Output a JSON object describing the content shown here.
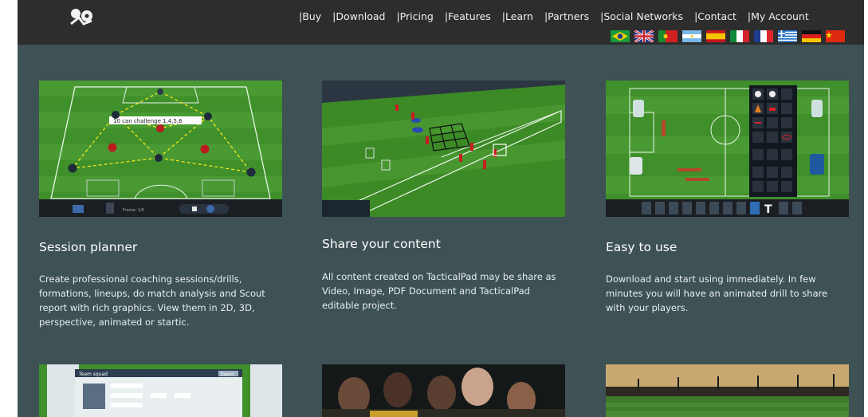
{
  "nav": {
    "items": [
      "|Buy",
      "|Download",
      "|Pricing",
      "|Features",
      "|Learn",
      "|Partners",
      "|Social Networks",
      "|Contact",
      "|My Account"
    ]
  },
  "flags": [
    "brazil",
    "united-kingdom",
    "portugal",
    "argentina",
    "spain",
    "italy",
    "france",
    "greece",
    "germany",
    "china"
  ],
  "cards": [
    {
      "title": "Session planner",
      "desc": "Create professional coaching sessions/drills, formations, lineups, do match analysis and Scout report with rich graphics. View them in 2D, 3D, perspective, animated or startic.",
      "overlay_label": "10 can challenge 1,4,5,6",
      "toolbar_text": "Frame: 1/6"
    },
    {
      "title": "Share your content",
      "desc": "All content created on TacticalPad may be share as Video, Image, PDF Document and TacticalPad editable project."
    },
    {
      "title": "Easy to use",
      "desc": "Download and start using immediately. In few minutes you will have an animated drill to share with your players."
    }
  ],
  "bottom_thumbs": [
    {
      "header": "Team squad",
      "button": "Export"
    },
    {},
    {}
  ],
  "colors": {
    "page_bg": "#3e5155",
    "topbar_bg": "#2d2d2d",
    "pitch_green": "#3f8f2a"
  }
}
